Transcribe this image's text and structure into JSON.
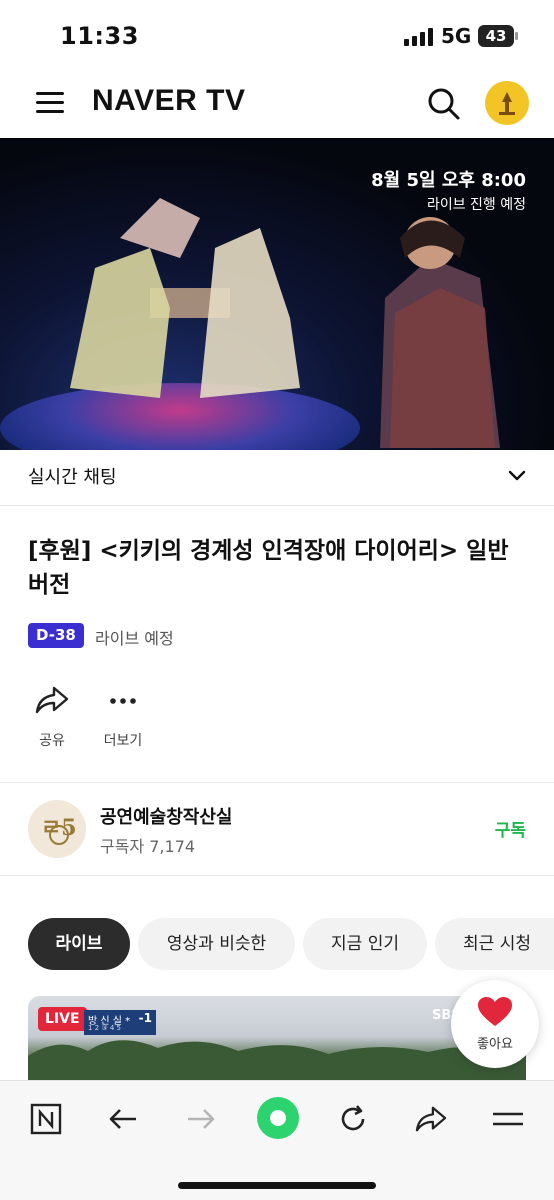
{
  "status_bar": {
    "time": "11:33",
    "network": "5G",
    "battery": "43"
  },
  "header": {
    "brand": "NAVER TV",
    "icons": [
      "menu-icon",
      "search-icon",
      "channel-avatar-icon"
    ]
  },
  "video": {
    "live_date": "8월 5일 오후 8:00",
    "live_status": "라이브 진행 예정"
  },
  "chat": {
    "label": "실시간 채팅"
  },
  "content": {
    "title": "[후원] <키키의 경계성 인격장애 다이어리> 일반 버전",
    "dday": "D-38",
    "schedule": "라이브 예정"
  },
  "actions": [
    {
      "label": "공유",
      "icon": "share-icon"
    },
    {
      "label": "더보기",
      "icon": "more-icon"
    }
  ],
  "channel": {
    "name": "공연예술창작산실",
    "subscribers": "구독자 7,174",
    "subscribe_label": "구독"
  },
  "tabs": [
    {
      "label": "라이브",
      "active": true
    },
    {
      "label": "영상과 비슷한",
      "active": false
    },
    {
      "label": "지금 인기",
      "active": false
    },
    {
      "label": "최근 시청",
      "active": false
    }
  ],
  "thumbnail": {
    "badge": "LIVE",
    "score_name": "방 신 실 *",
    "score_value": "-1",
    "score_sub": "1 2 ③ 4 5",
    "broadcaster": "SBS"
  },
  "like": {
    "label": "좋아요"
  },
  "bottom_nav": [
    "naver-home-icon",
    "back-icon",
    "forward-icon",
    "green-dot-icon",
    "refresh-icon",
    "share-icon",
    "menu-icon"
  ],
  "colors": {
    "accent_green": "#1fb84b",
    "dday_purple": "#3b2fd1",
    "live_red": "#e2263b",
    "like_red": "#e2263b"
  }
}
